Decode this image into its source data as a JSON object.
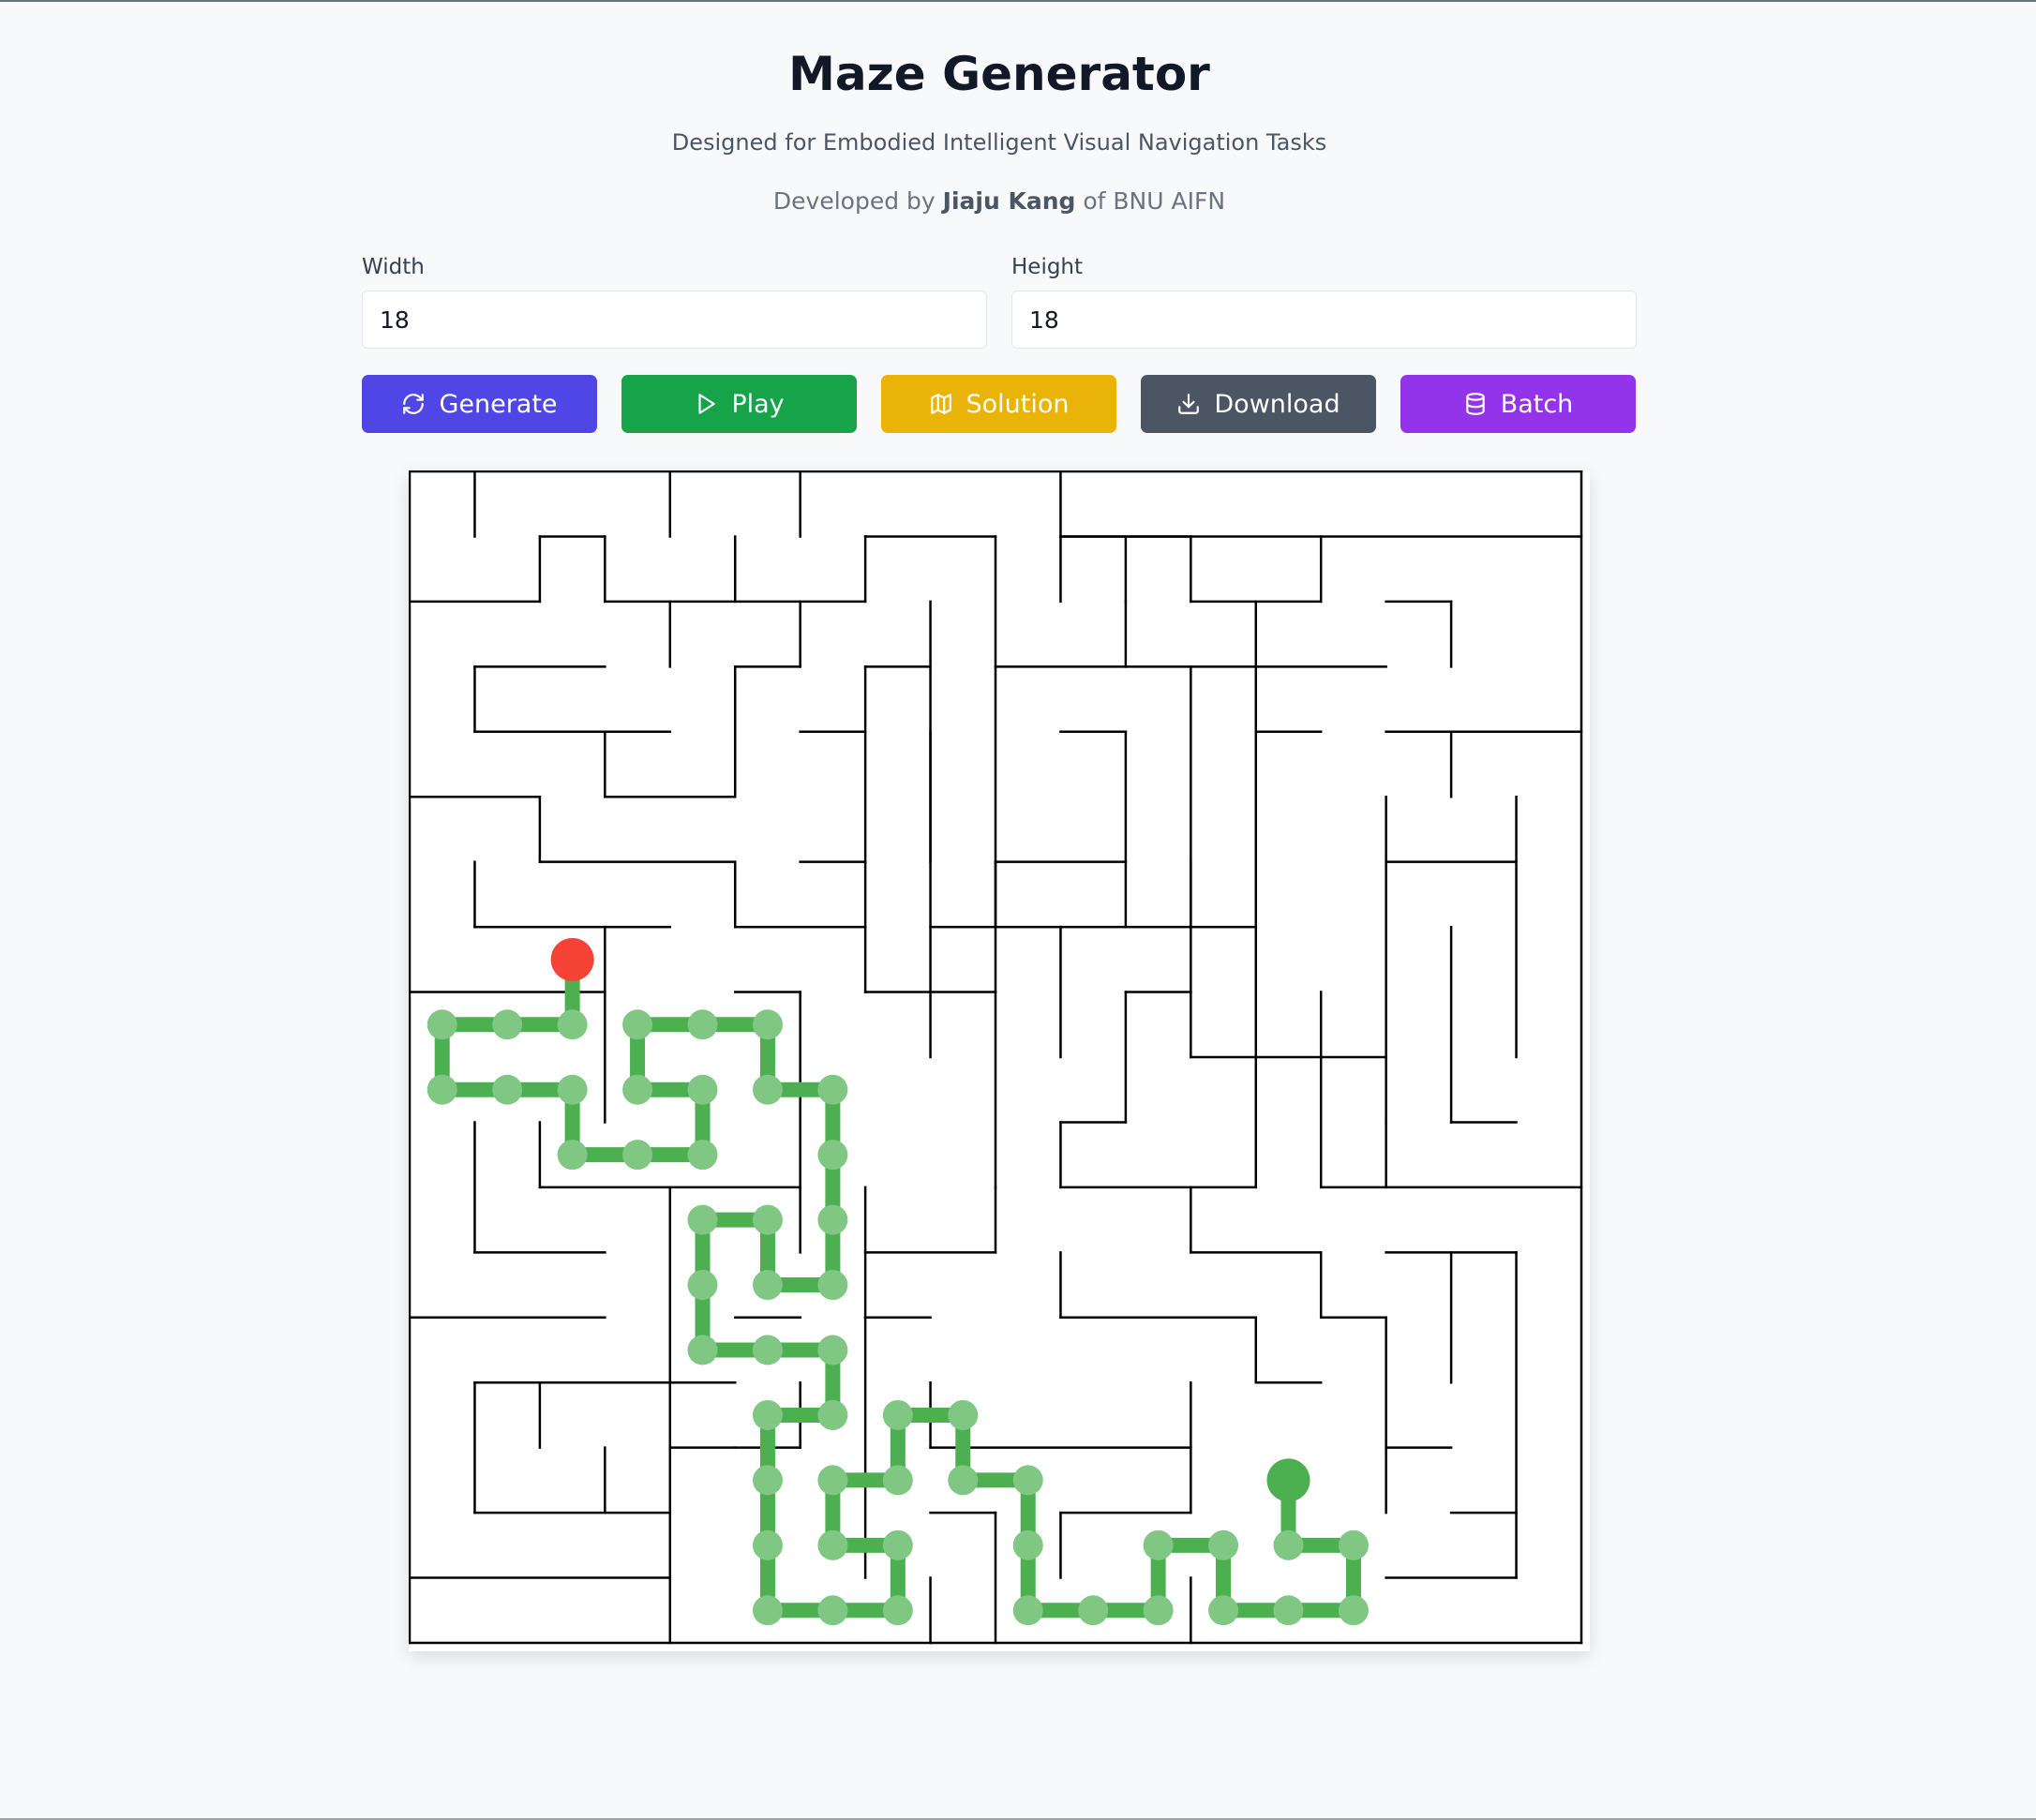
{
  "header": {
    "title": "Maze Generator",
    "subtitle": "Designed for Embodied Intelligent Visual Navigation Tasks",
    "credit_prefix": "Developed by",
    "credit_name": "Jiaju Kang",
    "credit_suffix": "of BNU AIFN"
  },
  "controls": {
    "width_label": "Width",
    "width_value": "18",
    "height_label": "Height",
    "height_value": "18"
  },
  "buttons": [
    {
      "label": "Generate",
      "icon": "refresh-icon",
      "color": "#4f46e5"
    },
    {
      "label": "Play",
      "icon": "play-icon",
      "color": "#16a34a"
    },
    {
      "label": "Solution",
      "icon": "map-icon",
      "color": "#eab308"
    },
    {
      "label": "Download",
      "icon": "download-icon",
      "color": "#4b5563"
    },
    {
      "label": "Batch",
      "icon": "database-icon",
      "color": "#9333ea"
    }
  ],
  "maze": {
    "cols": 18,
    "rows": 18,
    "wall_color": "#000000",
    "path_color": "#4caf50",
    "node_color": "#81c784",
    "start_marker_color": "#f44336",
    "end_marker_color": "#4caf50",
    "start_cell": [
      2,
      7
    ],
    "end_cell": [
      13,
      15
    ],
    "solution_path": [
      [
        2,
        7
      ],
      [
        2,
        8
      ],
      [
        1,
        8
      ],
      [
        0,
        8
      ],
      [
        0,
        9
      ],
      [
        1,
        9
      ],
      [
        2,
        9
      ],
      [
        2,
        10
      ],
      [
        3,
        10
      ],
      [
        4,
        10
      ],
      [
        4,
        9
      ],
      [
        3,
        9
      ],
      [
        3,
        8
      ],
      [
        4,
        8
      ],
      [
        5,
        8
      ],
      [
        5,
        9
      ],
      [
        6,
        9
      ],
      [
        6,
        10
      ],
      [
        6,
        11
      ],
      [
        6,
        12
      ],
      [
        5,
        12
      ],
      [
        5,
        11
      ],
      [
        4,
        11
      ],
      [
        4,
        12
      ],
      [
        4,
        13
      ],
      [
        5,
        13
      ],
      [
        6,
        13
      ],
      [
        6,
        14
      ],
      [
        5,
        14
      ],
      [
        5,
        15
      ],
      [
        5,
        16
      ],
      [
        5,
        17
      ],
      [
        6,
        17
      ],
      [
        7,
        17
      ],
      [
        7,
        16
      ],
      [
        6,
        16
      ],
      [
        6,
        15
      ],
      [
        7,
        15
      ],
      [
        7,
        14
      ],
      [
        8,
        14
      ],
      [
        8,
        15
      ],
      [
        9,
        15
      ],
      [
        9,
        16
      ],
      [
        9,
        17
      ],
      [
        10,
        17
      ],
      [
        11,
        17
      ],
      [
        11,
        16
      ],
      [
        12,
        16
      ],
      [
        12,
        17
      ],
      [
        13,
        17
      ],
      [
        14,
        17
      ],
      [
        14,
        16
      ],
      [
        13,
        16
      ],
      [
        13,
        15
      ]
    ],
    "walls": [
      [
        0,
        0,
        18,
        0
      ],
      [
        0,
        18,
        18,
        18
      ],
      [
        0,
        0,
        0,
        18
      ],
      [
        18,
        0,
        18,
        18
      ],
      [
        1,
        0,
        1,
        1
      ],
      [
        4,
        0,
        4,
        1
      ],
      [
        6,
        0,
        6,
        1
      ],
      [
        10,
        0,
        10,
        2
      ],
      [
        10,
        1,
        18,
        1
      ],
      [
        2,
        1,
        3,
        1
      ],
      [
        2,
        1,
        2,
        2
      ],
      [
        3,
        1,
        3,
        2
      ],
      [
        3,
        2,
        7,
        2
      ],
      [
        0,
        2,
        2,
        2
      ],
      [
        5,
        1,
        5,
        2
      ],
      [
        7,
        1,
        9,
        1
      ],
      [
        7,
        1,
        7,
        2
      ],
      [
        9,
        1,
        9,
        7
      ],
      [
        10,
        1,
        12,
        1
      ],
      [
        12,
        1,
        12,
        2
      ],
      [
        11,
        1,
        11,
        2
      ],
      [
        12,
        2,
        14,
        2
      ],
      [
        14,
        1,
        14,
        2
      ],
      [
        8,
        2,
        8,
        9
      ],
      [
        4,
        2,
        4,
        3
      ],
      [
        6,
        2,
        6,
        3
      ],
      [
        5,
        3,
        6,
        3
      ],
      [
        5,
        3,
        5,
        5
      ],
      [
        7,
        3,
        7,
        6
      ],
      [
        7,
        3,
        8,
        3
      ],
      [
        11,
        2,
        11,
        3
      ],
      [
        11,
        3,
        13,
        3
      ],
      [
        13,
        2,
        13,
        4
      ],
      [
        13,
        3,
        15,
        3
      ],
      [
        15,
        2,
        16,
        2
      ],
      [
        16,
        2,
        16,
        3
      ],
      [
        1,
        3,
        3,
        3
      ],
      [
        1,
        3,
        1,
        4
      ],
      [
        1,
        4,
        4,
        4
      ],
      [
        3,
        4,
        3,
        5
      ],
      [
        3,
        5,
        5,
        5
      ],
      [
        9,
        3,
        11,
        3
      ],
      [
        12,
        3,
        12,
        8
      ],
      [
        6,
        4,
        7,
        4
      ],
      [
        8,
        4,
        8,
        6
      ],
      [
        10,
        4,
        11,
        4
      ],
      [
        11,
        4,
        11,
        6
      ],
      [
        9,
        6,
        11,
        6
      ],
      [
        9,
        6,
        9,
        7
      ],
      [
        13,
        4,
        14,
        4
      ],
      [
        13,
        4,
        13,
        9
      ],
      [
        15,
        4,
        18,
        4
      ],
      [
        16,
        4,
        16,
        5
      ],
      [
        0,
        5,
        2,
        5
      ],
      [
        2,
        5,
        2,
        6
      ],
      [
        2,
        6,
        5,
        6
      ],
      [
        5,
        6,
        5,
        7
      ],
      [
        5,
        7,
        7,
        7
      ],
      [
        6,
        6,
        7,
        6
      ],
      [
        7,
        6,
        7,
        8
      ],
      [
        7,
        8,
        9,
        8
      ],
      [
        9,
        7,
        9,
        8
      ],
      [
        1,
        6,
        1,
        7
      ],
      [
        1,
        7,
        4,
        7
      ],
      [
        11,
        6,
        11,
        7
      ],
      [
        15,
        5,
        15,
        10
      ],
      [
        15,
        6,
        17,
        6
      ],
      [
        17,
        5,
        17,
        9
      ],
      [
        16,
        7,
        16,
        10
      ],
      [
        3,
        7,
        3,
        10
      ],
      [
        8,
        7,
        10,
        7
      ],
      [
        10,
        7,
        12,
        7
      ],
      [
        10,
        7,
        10,
        9
      ],
      [
        12,
        6,
        12,
        7
      ],
      [
        12,
        7,
        13,
        7
      ],
      [
        12,
        8,
        12,
        9
      ],
      [
        12,
        9,
        14,
        9
      ],
      [
        14,
        8,
        14,
        11
      ],
      [
        14,
        9,
        15,
        9
      ],
      [
        0,
        8,
        3,
        8
      ],
      [
        6,
        8,
        6,
        11
      ],
      [
        5,
        8,
        6,
        8
      ],
      [
        9,
        8,
        9,
        11
      ],
      [
        11,
        8,
        11,
        10
      ],
      [
        11,
        8,
        12,
        8
      ],
      [
        10,
        10,
        11,
        10
      ],
      [
        1,
        10,
        1,
        12
      ],
      [
        1,
        12,
        3,
        12
      ],
      [
        2,
        10,
        2,
        11
      ],
      [
        2,
        11,
        6,
        11
      ],
      [
        6,
        11,
        6,
        12
      ],
      [
        7,
        11,
        7,
        13
      ],
      [
        10,
        10,
        10,
        11
      ],
      [
        10,
        11,
        13,
        11
      ],
      [
        13,
        9,
        13,
        11
      ],
      [
        14,
        11,
        18,
        11
      ],
      [
        15,
        10,
        15,
        11
      ],
      [
        16,
        10,
        17,
        10
      ],
      [
        7,
        12,
        9,
        12
      ],
      [
        9,
        11,
        9,
        12
      ],
      [
        12,
        11,
        12,
        12
      ],
      [
        12,
        12,
        14,
        12
      ],
      [
        14,
        12,
        14,
        13
      ],
      [
        15,
        12,
        17,
        12
      ],
      [
        16,
        12,
        16,
        14
      ],
      [
        17,
        12,
        17,
        17
      ],
      [
        0,
        13,
        3,
        13
      ],
      [
        4,
        11,
        4,
        14
      ],
      [
        5,
        13,
        6,
        13
      ],
      [
        7,
        13,
        7,
        17
      ],
      [
        7,
        13,
        8,
        13
      ],
      [
        10,
        12,
        10,
        13
      ],
      [
        10,
        13,
        13,
        13
      ],
      [
        13,
        13,
        13,
        14
      ],
      [
        13,
        14,
        14,
        14
      ],
      [
        14,
        13,
        15,
        13
      ],
      [
        15,
        13,
        15,
        16
      ],
      [
        1,
        14,
        1,
        16
      ],
      [
        1,
        14,
        5,
        14
      ],
      [
        2,
        14,
        2,
        15
      ],
      [
        4,
        14,
        4,
        18
      ],
      [
        6,
        14,
        6,
        15
      ],
      [
        5,
        15,
        6,
        15
      ],
      [
        8,
        14,
        8,
        15
      ],
      [
        8,
        15,
        12,
        15
      ],
      [
        12,
        14,
        12,
        15
      ],
      [
        15,
        15,
        16,
        15
      ],
      [
        3,
        15,
        3,
        16
      ],
      [
        1,
        16,
        4,
        16
      ],
      [
        4,
        15,
        5,
        15
      ],
      [
        8,
        16,
        9,
        16
      ],
      [
        9,
        16,
        9,
        18
      ],
      [
        10,
        16,
        10,
        17
      ],
      [
        10,
        16,
        12,
        16
      ],
      [
        12,
        15,
        12,
        16
      ],
      [
        16,
        16,
        17,
        16
      ],
      [
        15,
        17,
        17,
        17
      ],
      [
        0,
        17,
        4,
        17
      ],
      [
        12,
        17,
        12,
        18
      ],
      [
        8,
        18,
        8,
        18
      ],
      [
        8,
        17,
        8,
        18
      ]
    ]
  }
}
